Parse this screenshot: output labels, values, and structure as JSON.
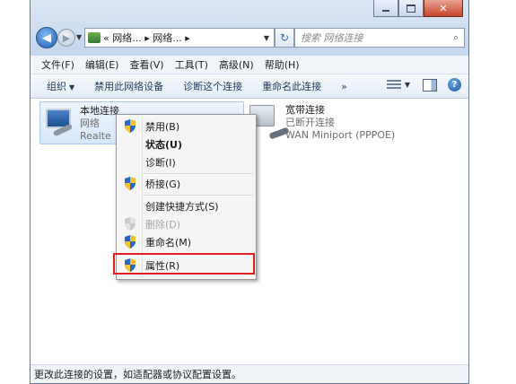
{
  "window": {
    "caption": {
      "minimize": "–",
      "maximize": "□",
      "close": "✕"
    }
  },
  "address": {
    "path": "« 网络... ▸ 网络... ▸",
    "search_placeholder": "搜索 网络连接"
  },
  "menubar": [
    "文件(F)",
    "编辑(E)",
    "查看(V)",
    "工具(T)",
    "高级(N)",
    "帮助(H)"
  ],
  "commandbar": {
    "organize": "组织",
    "disable": "禁用此网络设备",
    "diagnose": "诊断这个连接",
    "rename": "重命名此连接",
    "more": "»"
  },
  "connections": {
    "local": {
      "title": "本地连接",
      "line2": "网络",
      "line3": "Realte"
    },
    "broadband": {
      "title": "宽带连接",
      "line2": "已断开连接",
      "line3": "WAN Miniport (PPPOE)"
    }
  },
  "context_menu": {
    "items": [
      {
        "label": "禁用(B)",
        "icon": "uac-shield-icon"
      },
      {
        "label": "状态(U)"
      },
      {
        "label": "诊断(I)"
      },
      {
        "label": "桥接(G)",
        "icon": "uac-shield-icon"
      },
      {
        "label": "创建快捷方式(S)"
      },
      {
        "label": "删除(D)",
        "icon": "uac-shield-icon",
        "disabled": true
      },
      {
        "label": "重命名(M)",
        "icon": "uac-shield-icon"
      },
      {
        "label": "属性(R)",
        "icon": "uac-shield-icon",
        "highlighted": true
      }
    ]
  },
  "status_bar": "更改此连接的设置，如适配器或协议配置设置。",
  "colors": {
    "highlight_border": "#e02020",
    "accent": "#1e5fb5"
  }
}
